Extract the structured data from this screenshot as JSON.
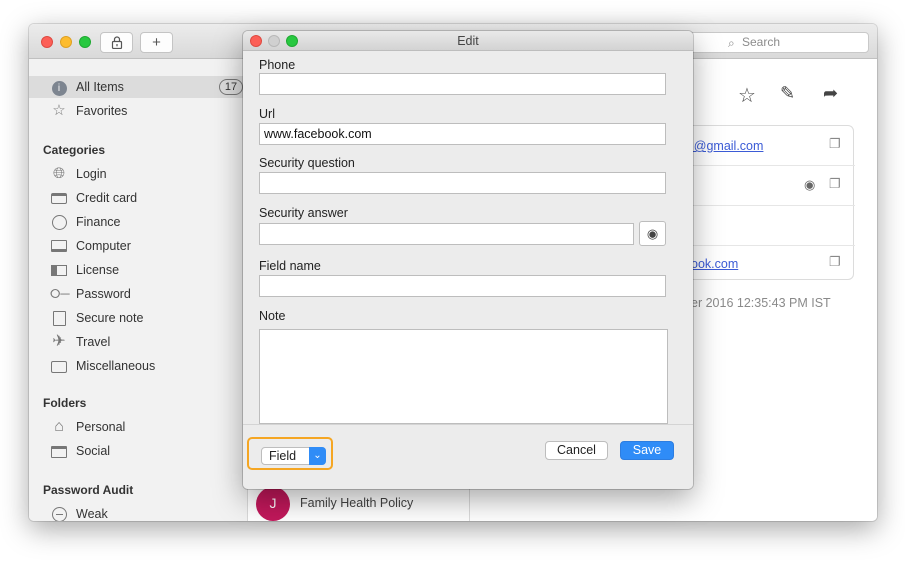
{
  "window": {
    "new_item_label": "+",
    "search_placeholder": "Search"
  },
  "sidebar": {
    "all_items": {
      "label": "All Items",
      "count": "17"
    },
    "favorites": {
      "label": "Favorites"
    },
    "categories_heading": "Categories",
    "categories": [
      {
        "label": "Login",
        "icon": "globe-icon"
      },
      {
        "label": "Credit card",
        "icon": "credit-card-icon"
      },
      {
        "label": "Finance",
        "icon": "coin-icon"
      },
      {
        "label": "Computer",
        "icon": "monitor-icon"
      },
      {
        "label": "License",
        "icon": "license-icon"
      },
      {
        "label": "Password",
        "icon": "key-icon"
      },
      {
        "label": "Secure note",
        "icon": "note-icon"
      },
      {
        "label": "Travel",
        "icon": "airplane-icon"
      },
      {
        "label": "Miscellaneous",
        "icon": "briefcase-icon"
      }
    ],
    "folders_heading": "Folders",
    "folders": [
      {
        "label": "Personal",
        "icon": "home-icon"
      },
      {
        "label": "Social",
        "icon": "folder-icon"
      }
    ],
    "audit_heading": "Password Audit",
    "audit": [
      {
        "label": "Weak",
        "icon": "minus-circle-icon"
      }
    ]
  },
  "middle": {
    "visible_item": {
      "initial": "J",
      "subtitle": "Family Health Policy"
    }
  },
  "detail": {
    "email_partial": "l@gmail.com",
    "url_partial": "ook.com",
    "timestamp_partial": "er 2016 12:35:43 PM IST"
  },
  "dialog": {
    "title": "Edit",
    "phone_label": "Phone",
    "phone_value": "",
    "url_label": "Url",
    "url_value": "www.facebook.com",
    "security_question_label": "Security question",
    "security_question_value": "",
    "security_answer_label": "Security answer",
    "security_answer_value": "",
    "field_name_label": "Field name",
    "field_name_value": "",
    "note_label": "Note",
    "field_dropdown_label": "Field",
    "cancel_label": "Cancel",
    "save_label": "Save"
  },
  "colors": {
    "accent": "#2f8cf7",
    "highlight": "#f5a623",
    "link": "#3b5bd6",
    "avatar": "#c2185b"
  }
}
